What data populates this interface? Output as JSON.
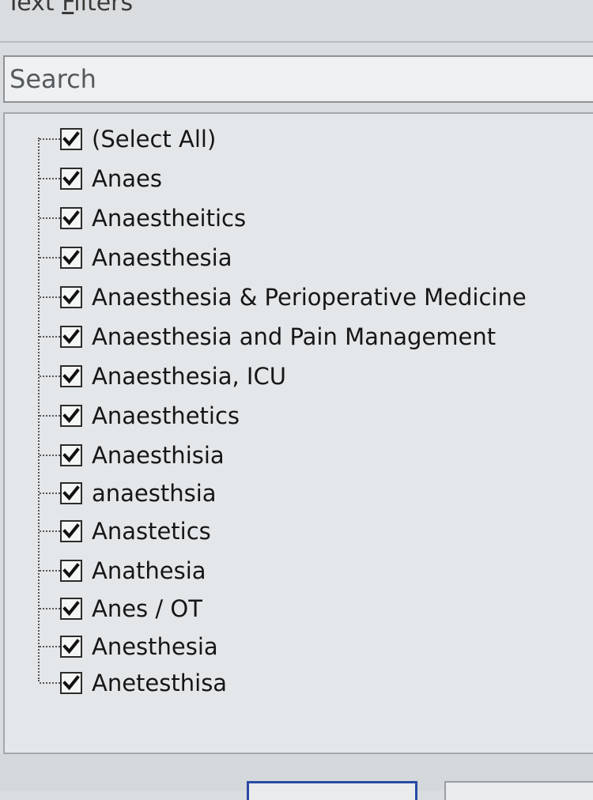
{
  "header": {
    "title_prefix": "Text ",
    "title_accel": "F",
    "title_rest": "ilters"
  },
  "search": {
    "placeholder": "Search",
    "value": ""
  },
  "list": {
    "items": [
      {
        "label": "(Select All)",
        "checked": true
      },
      {
        "label": "Anaes",
        "checked": true
      },
      {
        "label": "Anaestheitics",
        "checked": true
      },
      {
        "label": "Anaesthesia",
        "checked": true
      },
      {
        "label": "Anaesthesia & Perioperative Medicine",
        "checked": true
      },
      {
        "label": "Anaesthesia and Pain Management",
        "checked": true
      },
      {
        "label": "Anaesthesia, ICU",
        "checked": true
      },
      {
        "label": "Anaesthetics",
        "checked": true
      },
      {
        "label": "Anaesthisia",
        "checked": true
      },
      {
        "label": "anaesthsia",
        "checked": true
      },
      {
        "label": "Anastetics",
        "checked": true
      },
      {
        "label": "Anathesia",
        "checked": true
      },
      {
        "label": "Anes / OT",
        "checked": true
      },
      {
        "label": "Anesthesia",
        "checked": true
      },
      {
        "label": "Anetesthisa",
        "checked": true
      }
    ]
  },
  "icons": {
    "checkbox_checked": "check-icon"
  }
}
